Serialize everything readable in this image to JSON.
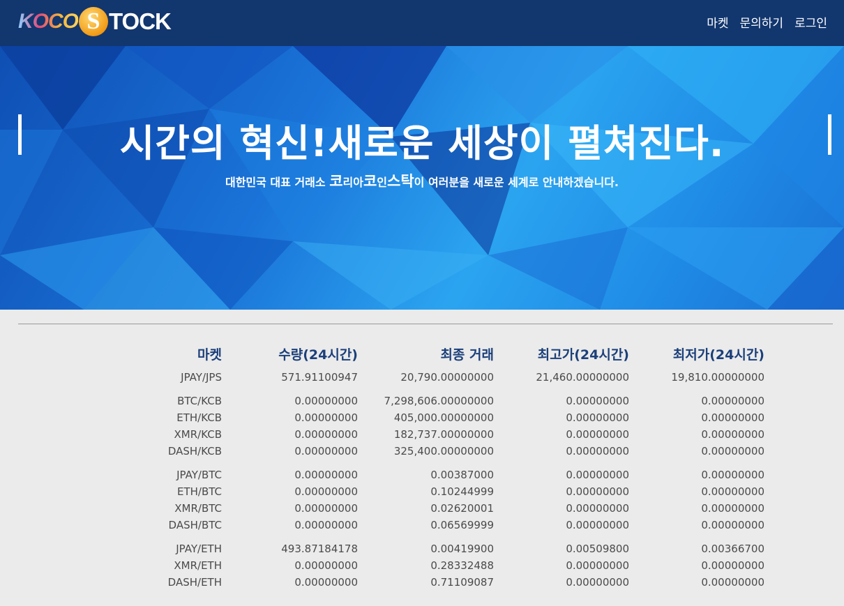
{
  "brand": {
    "logo_part1": "KOCO",
    "logo_coin": "S",
    "logo_part2": "TOCK"
  },
  "nav": {
    "items": [
      "마켓",
      "문의하기",
      "로그인"
    ]
  },
  "hero": {
    "title": "시간의 혁신!새로운 세상이 펼쳐진다.",
    "subtitle_parts": [
      "대한민국 대표 거래소 ",
      "코",
      "리아",
      "코",
      "인",
      "스탁",
      "이 여러분을 새로운 세계로 안내하겠습니다."
    ]
  },
  "market": {
    "headers": [
      "마켓",
      "수량(24시간)",
      "최종 거래",
      "최고가(24시간)",
      "최저가(24시간)"
    ],
    "groups": [
      [
        [
          "JPAY/JPS",
          "571.91100947",
          "20,790.00000000",
          "21,460.00000000",
          "19,810.00000000"
        ]
      ],
      [
        [
          "BTC/KCB",
          "0.00000000",
          "7,298,606.00000000",
          "0.00000000",
          "0.00000000"
        ],
        [
          "ETH/KCB",
          "0.00000000",
          "405,000.00000000",
          "0.00000000",
          "0.00000000"
        ],
        [
          "XMR/KCB",
          "0.00000000",
          "182,737.00000000",
          "0.00000000",
          "0.00000000"
        ],
        [
          "DASH/KCB",
          "0.00000000",
          "325,400.00000000",
          "0.00000000",
          "0.00000000"
        ]
      ],
      [
        [
          "JPAY/BTC",
          "0.00000000",
          "0.00387000",
          "0.00000000",
          "0.00000000"
        ],
        [
          "ETH/BTC",
          "0.00000000",
          "0.10244999",
          "0.00000000",
          "0.00000000"
        ],
        [
          "XMR/BTC",
          "0.00000000",
          "0.02620001",
          "0.00000000",
          "0.00000000"
        ],
        [
          "DASH/BTC",
          "0.00000000",
          "0.06569999",
          "0.00000000",
          "0.00000000"
        ]
      ],
      [
        [
          "JPAY/ETH",
          "493.87184178",
          "0.00419900",
          "0.00509800",
          "0.00366700"
        ],
        [
          "XMR/ETH",
          "0.00000000",
          "0.28332488",
          "0.00000000",
          "0.00000000"
        ],
        [
          "DASH/ETH",
          "0.00000000",
          "0.71109087",
          "0.00000000",
          "0.00000000"
        ]
      ]
    ]
  },
  "colors": {
    "topbar": "#12366e",
    "page_bg": "#ebebeb",
    "header_text": "#1b3f7a",
    "hero_blue": "#2ba4f0"
  }
}
